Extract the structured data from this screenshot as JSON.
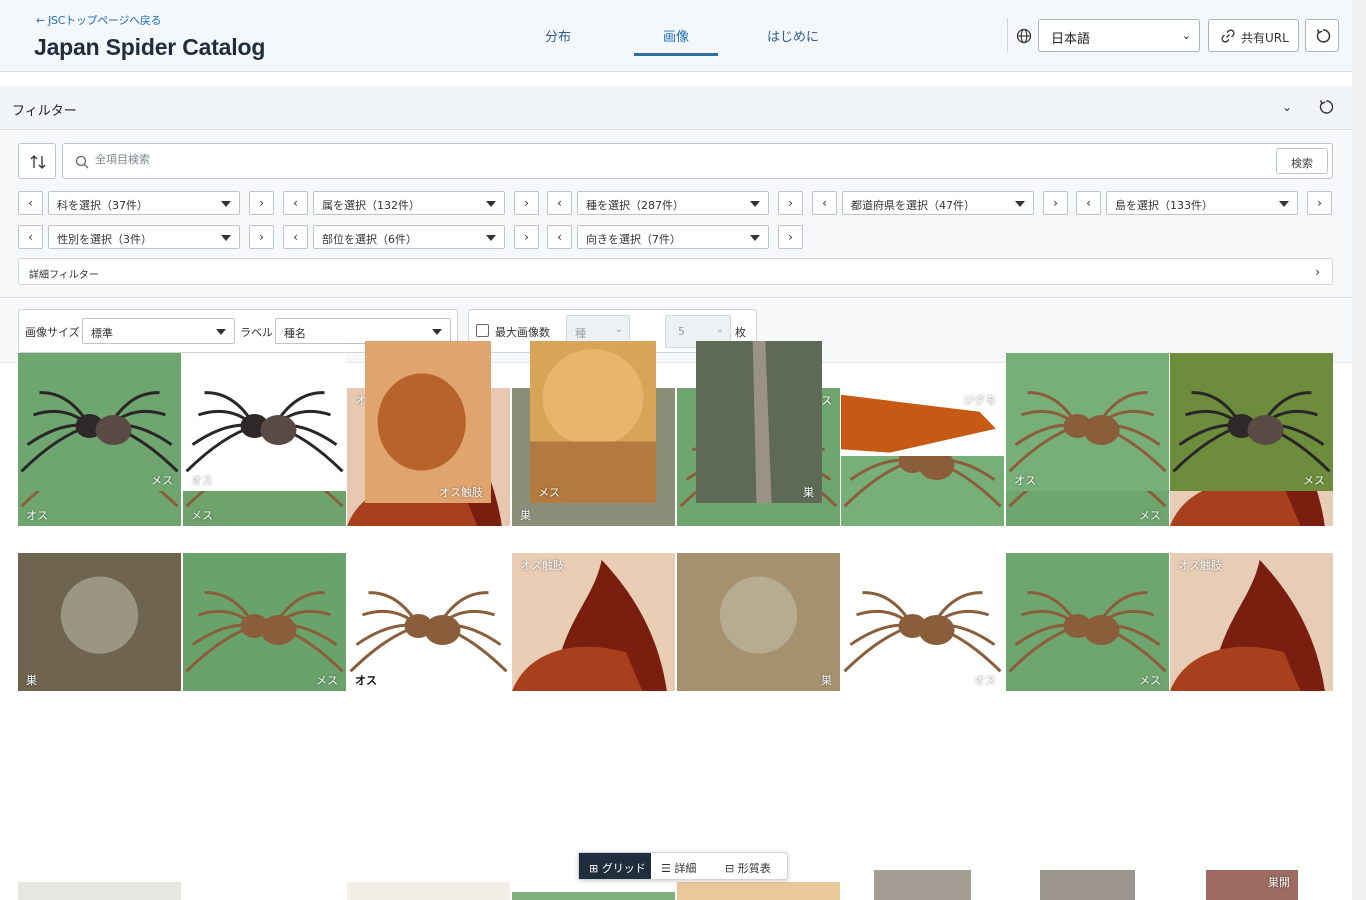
{
  "header": {
    "back_link": "← JSCトップページへ戻る",
    "title": "Japan Spider Catalog",
    "tabs": [
      {
        "label": "分布"
      },
      {
        "label": "画像"
      },
      {
        "label": "はじめに"
      }
    ],
    "language": "日本語",
    "share_label": "共有URL"
  },
  "filters": {
    "title": "フィルター",
    "search_placeholder": "全項目検索",
    "search_button": "検索",
    "row1": [
      "科を選択（37件）",
      "属を選択（132件）",
      "種を選択（287件）",
      "都道府県を選択（47件）",
      "島を選択（133件）"
    ],
    "row2": [
      "性別を選択（3件）",
      "部位を選択（6件）",
      "向きを選択（7件）"
    ],
    "advanced": "詳細フィルター"
  },
  "options": {
    "image_size_label": "画像サイズ",
    "image_size_value": "標準",
    "label_label": "ラベル",
    "label_value": "種名",
    "max_images_label": "最大画像数",
    "per_value": "種",
    "count_value": "5",
    "count_unit": "枚"
  },
  "view_toggle": {
    "grid": "グリッド",
    "detail": "詳細",
    "table": "形質表"
  },
  "gallery": {
    "row1": [
      {
        "caption": "オス",
        "pos": "bl",
        "bg": "#6fa56f",
        "kind": "spider"
      },
      {
        "caption": "メス",
        "pos": "bl",
        "bg": "#6ea36c",
        "kind": "spider"
      },
      {
        "caption": "オス触肢",
        "pos": "tl",
        "bg": "#e9c8b1",
        "kind": "palp"
      },
      {
        "caption": "巣",
        "pos": "bl",
        "bg": "#8a8f78",
        "kind": "nest"
      },
      {
        "caption": "メス",
        "pos": "tr",
        "bg": "#6fa56f",
        "kind": "spider"
      },
      {
        "caption": "オス",
        "pos": "tl",
        "bg": "#78ae78",
        "kind": "spider"
      },
      {
        "caption": "メス",
        "pos": "br",
        "bg": "#6fa56f",
        "kind": "spider"
      },
      {
        "caption": "オス触肢",
        "pos": "tl",
        "bg": "#e8cdb6",
        "kind": "palp"
      }
    ],
    "row2": [
      {
        "caption": "巣",
        "pos": "bl",
        "bg": "#6e6450",
        "kind": "nest"
      },
      {
        "caption": "メス",
        "pos": "br",
        "bg": "#6aa26c",
        "kind": "spider"
      },
      {
        "caption": "オス",
        "pos": "bl",
        "bg": "#ffffff",
        "kind": "spider",
        "dark": true
      },
      {
        "caption": "オス触肢",
        "pos": "tl",
        "bg": "#eacdb5",
        "kind": "palp"
      },
      {
        "caption": "巣",
        "pos": "br",
        "bg": "#a6916e",
        "kind": "nest"
      },
      {
        "caption": "オス",
        "pos": "br",
        "bg": "#ffffff",
        "kind": "spider"
      },
      {
        "caption": "メス",
        "pos": "br",
        "bg": "#6fa56f",
        "kind": "spider"
      },
      {
        "caption": "オス触肢",
        "pos": "tl",
        "bg": "#e8cdb6",
        "kind": "palp"
      }
    ],
    "row3": [
      {
        "caption": "メス",
        "pos": "br",
        "bg": "#6fa56f",
        "kind": "spider-dark"
      },
      {
        "caption": "オス",
        "pos": "bl",
        "bg": "#ffffff",
        "kind": "spider-dark"
      },
      {
        "caption": "オス触肢",
        "pos": "br",
        "bg": "#e0a46e",
        "kind": "palp-orange"
      },
      {
        "caption": "メス",
        "pos": "bl",
        "bg": "#d7a458",
        "kind": "body-orange"
      },
      {
        "caption": "巣",
        "pos": "br",
        "bg": "#5f6a56",
        "kind": "nest-tree"
      },
      {
        "caption": "ジグモ",
        "pos": "tr",
        "bg": "#ffffff",
        "kind": "fang"
      },
      {
        "caption": "オス",
        "pos": "bl",
        "bg": "#78ae78",
        "kind": "spider"
      },
      {
        "caption": "メス",
        "pos": "br",
        "bg": "#6d8d3c",
        "kind": "spider-dark"
      }
    ],
    "row4_last_caption": "巣開"
  }
}
